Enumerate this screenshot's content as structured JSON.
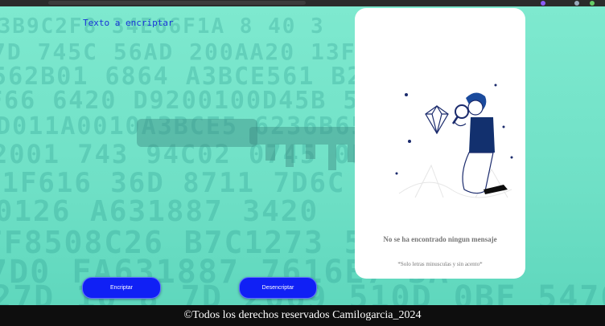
{
  "input": {
    "placeholder": "Texto a encriptar"
  },
  "buttons": {
    "encrypt_label": "Encriptar",
    "decrypt_label": "Desencriptar"
  },
  "panel": {
    "empty_title": "No se ha encontrado ningun mensaje",
    "hint": "*Solo letras minusculas y sin acento*"
  },
  "footer": {
    "text": "©Todos los derechos reservados Camilogarcia_2024"
  },
  "colors": {
    "accent": "#1020f5",
    "background": "#6fe3c8",
    "footer": "#0e0e0e"
  }
}
